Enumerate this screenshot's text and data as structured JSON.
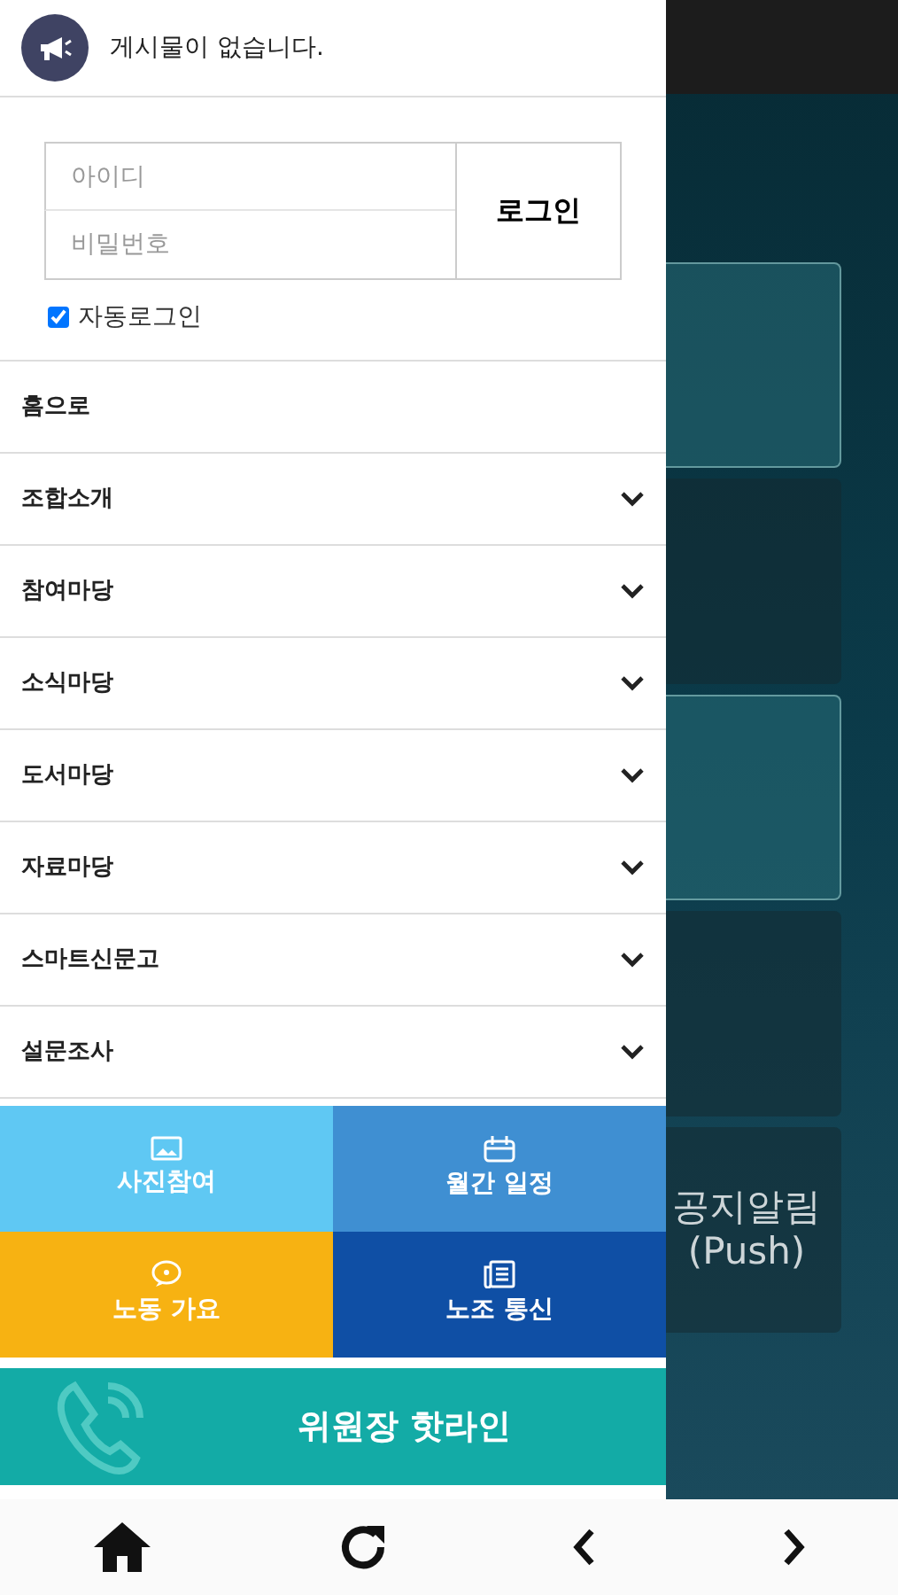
{
  "notice": {
    "text": "게시물이 없습니다."
  },
  "login": {
    "id_placeholder": "아이디",
    "password_placeholder": "비밀번호",
    "button": "로그인",
    "auto_login": {
      "label": "자동로그인",
      "checked": true
    }
  },
  "menu": [
    {
      "label": "홈으로",
      "expandable": false
    },
    {
      "label": "조합소개",
      "expandable": true
    },
    {
      "label": "참여마당",
      "expandable": true
    },
    {
      "label": "소식마당",
      "expandable": true
    },
    {
      "label": "도서마당",
      "expandable": true
    },
    {
      "label": "자료마당",
      "expandable": true
    },
    {
      "label": "스마트신문고",
      "expandable": true
    },
    {
      "label": "설문조사",
      "expandable": true
    }
  ],
  "tiles": [
    {
      "label": "사진참여",
      "kind": "photo",
      "color": "#5fc8f3"
    },
    {
      "label": "월간 일정",
      "kind": "calendar",
      "color": "#3f8fd2"
    },
    {
      "label": "노동 가요",
      "kind": "chat",
      "color": "#f7b212"
    },
    {
      "label": "노조 통신",
      "kind": "news",
      "color": "#0f4fa5"
    }
  ],
  "hotline": {
    "label": "위원장 핫라인"
  },
  "background": {
    "tile_text": "공지알림",
    "tile_subtext": "(Push)"
  },
  "bottom_nav": [
    {
      "kind": "home"
    },
    {
      "kind": "refresh"
    },
    {
      "kind": "back"
    },
    {
      "kind": "forward"
    }
  ]
}
